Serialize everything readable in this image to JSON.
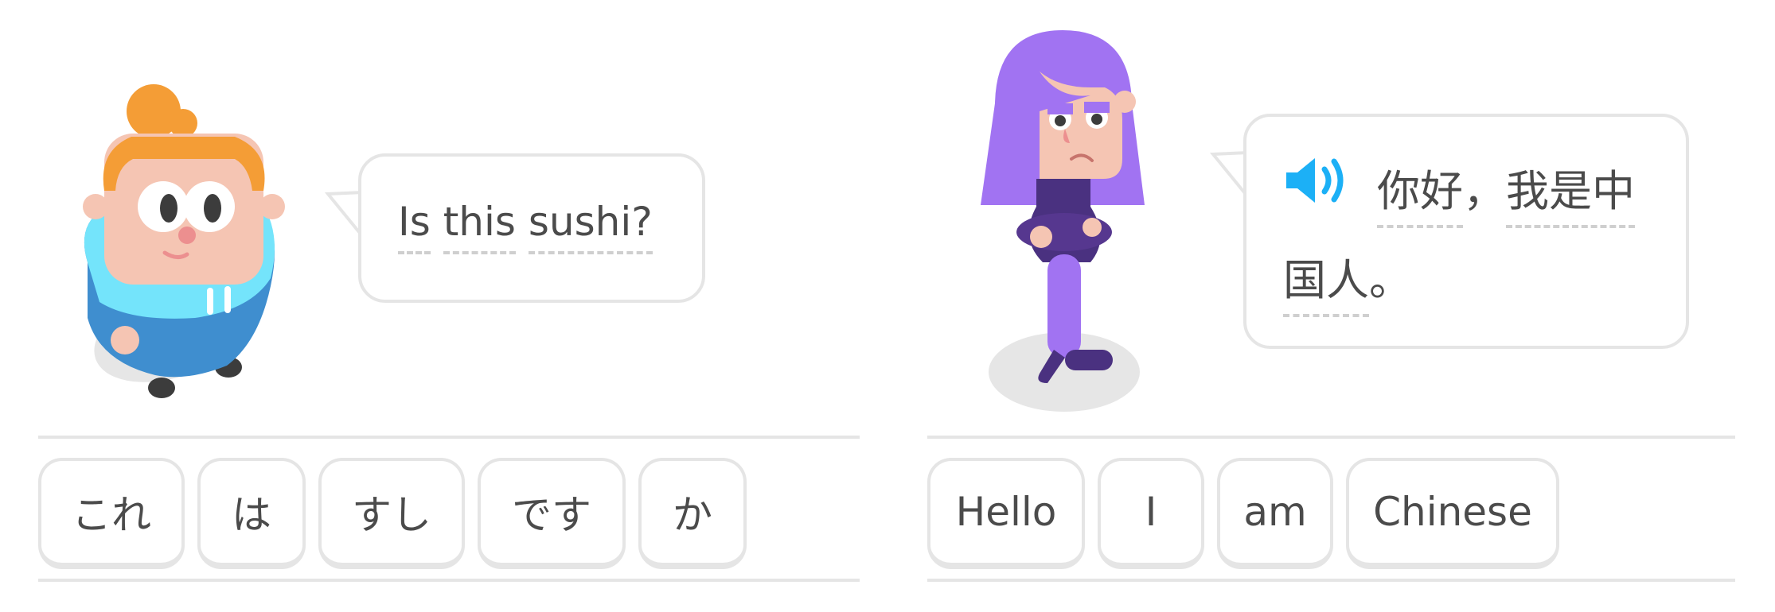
{
  "left": {
    "prompt_words": [
      "Is",
      "this",
      "sushi?"
    ],
    "choices": [
      "これ",
      "は",
      "すし",
      "です",
      "か"
    ]
  },
  "right": {
    "speaker_icon": "speaker-icon",
    "sentence": {
      "w1": "你好",
      "p1": "，",
      "w2": "我是中",
      "w3": "国人",
      "p2": "。"
    },
    "choices": [
      "Hello",
      "I",
      "am",
      "Chinese"
    ]
  },
  "colors": {
    "bubble_border": "#e5e5e5",
    "text": "#4b4b4b",
    "speaker_blue": "#1cb0f6",
    "purple_hair": "#a173f2",
    "hoodie_cyan": "#74e4fb",
    "orange_hair": "#f49d36"
  }
}
